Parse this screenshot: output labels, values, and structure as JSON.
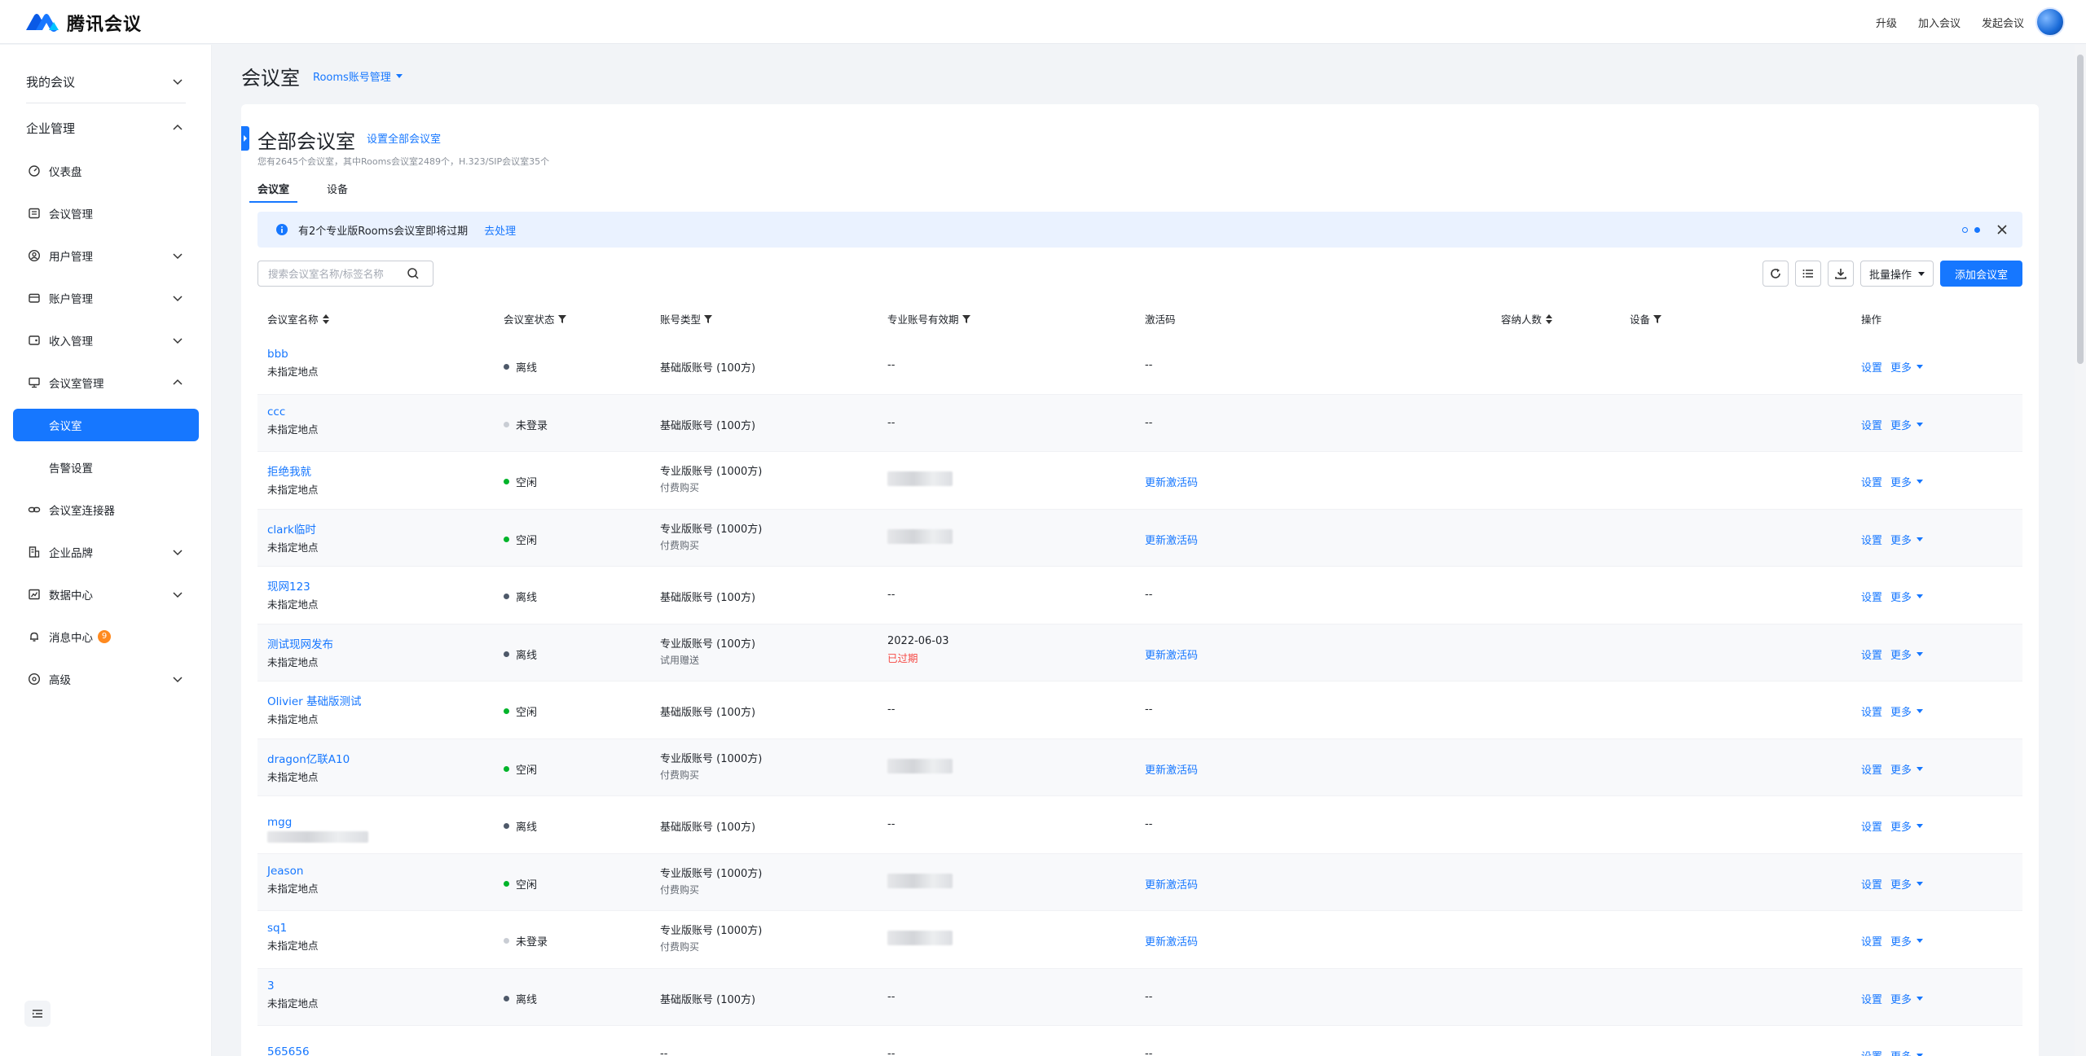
{
  "app": {
    "name": "腾讯会议"
  },
  "topbar": {
    "upgrade": "升级",
    "join": "加入会议",
    "start": "发起会议"
  },
  "sidebar": {
    "my_meetings": "我的会议",
    "enterprise": "企业管理",
    "items": {
      "dashboard": "仪表盘",
      "meeting_mgmt": "会议管理",
      "user_mgmt": "用户管理",
      "account_mgmt": "账户管理",
      "revenue_mgmt": "收入管理",
      "room_mgmt": "会议室管理",
      "rooms": "会议室",
      "alerts": "告警设置",
      "connector": "会议室连接器",
      "brand": "企业品牌",
      "data_center": "数据中心",
      "messages": "消息中心",
      "messages_badge": "9",
      "advanced": "高级"
    }
  },
  "page": {
    "title": "会议室",
    "switch": "Rooms账号管理"
  },
  "card": {
    "title": "全部会议室",
    "title_link": "设置全部会议室",
    "subtitle": "您有2645个会议室，其中Rooms会议室2489个，H.323/SIP会议室35个",
    "tabs": [
      "会议室",
      "设备"
    ]
  },
  "alert": {
    "text": "有2个专业版Rooms会议室即将过期",
    "link": "去处理"
  },
  "search": {
    "placeholder": "搜索会议室名称/标签名称"
  },
  "toolbar": {
    "batch": "批量操作",
    "add": "添加会议室"
  },
  "columns": {
    "name": "会议室名称",
    "status": "会议室状态",
    "account": "账号类型",
    "expiry": "专业账号有效期",
    "code": "激活码",
    "capacity": "容纳人数",
    "device": "设备",
    "ops": "操作"
  },
  "ops": {
    "settings": "设置",
    "more": "更多"
  },
  "status_colors": {
    "离线": "#4e5969",
    "未登录": "#c9cdd4",
    "空闲": "#00b42a"
  },
  "rows": [
    {
      "name": "bbb",
      "loc": "未指定地点",
      "status": "离线",
      "acct": "基础版账号 (100方)",
      "acct_sub": "",
      "expiry": "--",
      "expiry_note": "",
      "expiry_blur": false,
      "code": "--",
      "code_link": false
    },
    {
      "name": "ccc",
      "loc": "未指定地点",
      "status": "未登录",
      "acct": "基础版账号 (100方)",
      "acct_sub": "",
      "expiry": "--",
      "expiry_note": "",
      "expiry_blur": false,
      "code": "--",
      "code_link": false
    },
    {
      "name": "拒绝我就",
      "loc": "未指定地点",
      "status": "空闲",
      "acct": "专业版账号 (1000方)",
      "acct_sub": "付费购买",
      "expiry": "",
      "expiry_note": "",
      "expiry_blur": true,
      "code": "更新激活码",
      "code_link": true
    },
    {
      "name": "clark临时",
      "loc": "未指定地点",
      "status": "空闲",
      "acct": "专业版账号 (1000方)",
      "acct_sub": "付费购买",
      "expiry": "",
      "expiry_note": "",
      "expiry_blur": true,
      "code": "更新激活码",
      "code_link": true
    },
    {
      "name": "现网123",
      "loc": "未指定地点",
      "status": "离线",
      "acct": "基础版账号 (100方)",
      "acct_sub": "",
      "expiry": "--",
      "expiry_note": "",
      "expiry_blur": false,
      "code": "--",
      "code_link": false
    },
    {
      "name": "测试现网发布",
      "loc": "未指定地点",
      "status": "离线",
      "acct": "专业版账号 (100方)",
      "acct_sub": "试用赠送",
      "expiry": "2022-06-03",
      "expiry_note": "已过期",
      "expiry_blur": false,
      "code": "更新激活码",
      "code_link": true
    },
    {
      "name": "Olivier 基础版测试",
      "loc": "未指定地点",
      "status": "空闲",
      "acct": "基础版账号 (100方)",
      "acct_sub": "",
      "expiry": "--",
      "expiry_note": "",
      "expiry_blur": false,
      "code": "--",
      "code_link": false
    },
    {
      "name": "dragon亿联A10",
      "loc": "未指定地点",
      "status": "空闲",
      "acct": "专业版账号 (1000方)",
      "acct_sub": "付费购买",
      "expiry": "",
      "expiry_note": "",
      "expiry_blur": true,
      "code": "更新激活码",
      "code_link": true
    },
    {
      "name": "mgg",
      "loc": "",
      "status": "离线",
      "acct": "基础版账号 (100方)",
      "acct_sub": "",
      "expiry": "--",
      "expiry_note": "",
      "expiry_blur": false,
      "code": "--",
      "code_link": false
    },
    {
      "name": "Jeason",
      "loc": "未指定地点",
      "status": "空闲",
      "acct": "专业版账号 (1000方)",
      "acct_sub": "付费购买",
      "expiry": "",
      "expiry_note": "",
      "expiry_blur": true,
      "code": "更新激活码",
      "code_link": true
    },
    {
      "name": "sq1",
      "loc": "未指定地点",
      "status": "未登录",
      "acct": "专业版账号 (1000方)",
      "acct_sub": "付费购买",
      "expiry": "",
      "expiry_note": "",
      "expiry_blur": true,
      "code": "更新激活码",
      "code_link": true
    },
    {
      "name": "3",
      "loc": "未指定地点",
      "status": "离线",
      "acct": "基础版账号 (100方)",
      "acct_sub": "",
      "expiry": "--",
      "expiry_note": "",
      "expiry_blur": false,
      "code": "--",
      "code_link": false
    },
    {
      "name": "565656",
      "loc": "",
      "status": "",
      "acct": "--",
      "acct_sub": "",
      "expiry": "--",
      "expiry_note": "",
      "expiry_blur": false,
      "code": "--",
      "code_link": false
    }
  ]
}
